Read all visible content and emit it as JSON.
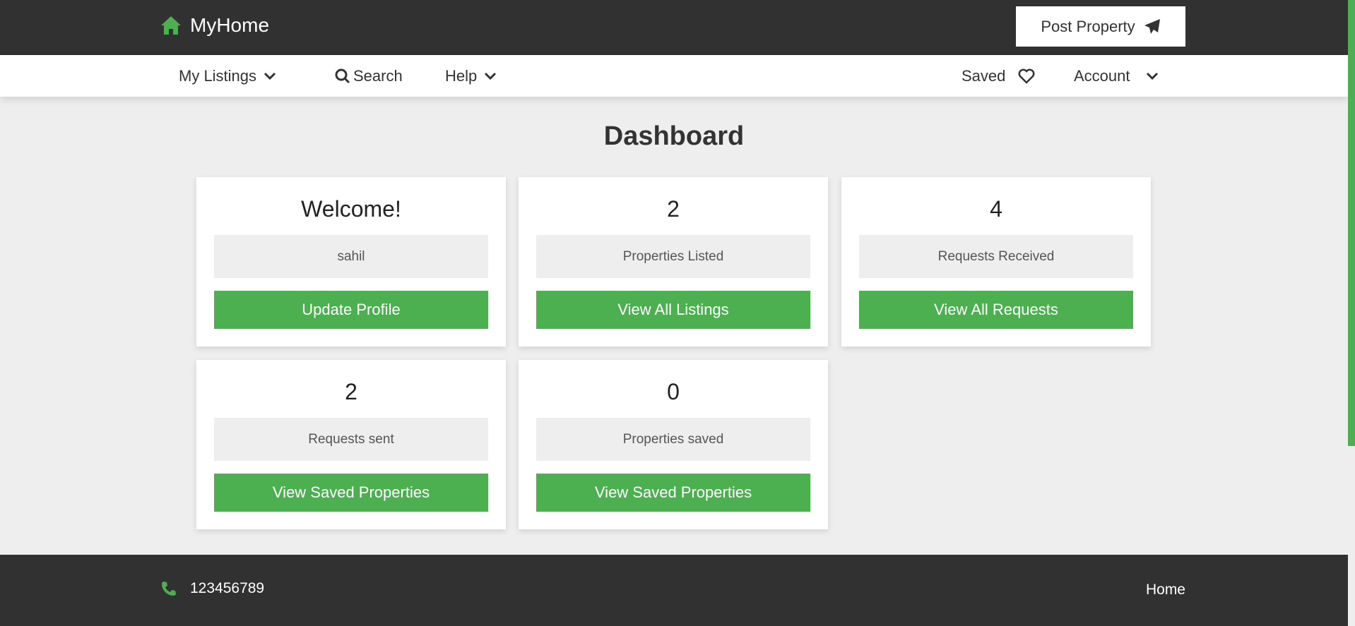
{
  "header": {
    "brand": "MyHome",
    "post_property": "Post Property"
  },
  "nav": {
    "my_listings": "My Listings",
    "search": "Search",
    "help": "Help",
    "saved": "Saved",
    "account": "Account"
  },
  "main": {
    "title": "Dashboard",
    "cards": [
      {
        "value": "Welcome!",
        "label": "sahil",
        "button": "Update Profile"
      },
      {
        "value": "2",
        "label": "Properties Listed",
        "button": "View All Listings"
      },
      {
        "value": "4",
        "label": "Requests Received",
        "button": "View All Requests"
      },
      {
        "value": "2",
        "label": "Requests sent",
        "button": "View Saved Properties"
      },
      {
        "value": "0",
        "label": "Properties saved",
        "button": "View Saved Properties"
      }
    ]
  },
  "footer": {
    "phone": "123456789",
    "home": "Home"
  },
  "colors": {
    "accent": "#4caf50",
    "dark": "#313131"
  }
}
